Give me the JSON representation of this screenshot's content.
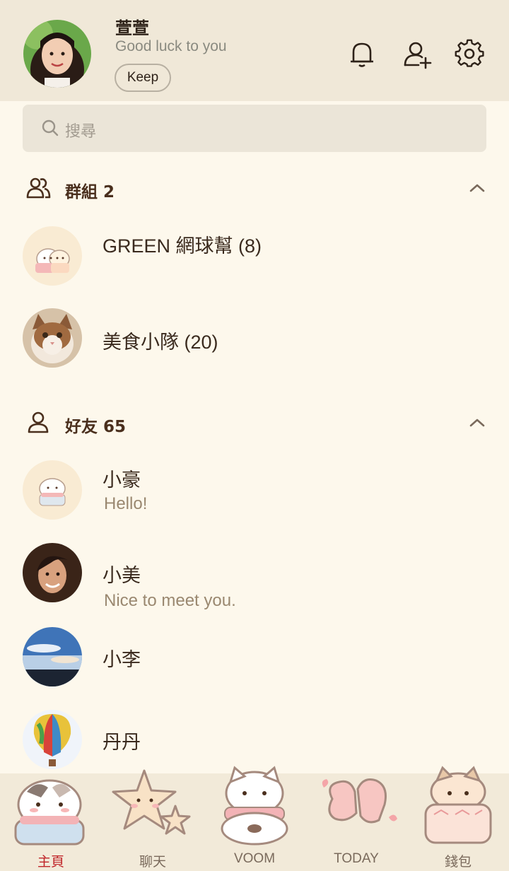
{
  "profile": {
    "name": "萱萱",
    "status": "Good luck to you",
    "keep_label": "Keep"
  },
  "header_icons": [
    "bell-icon",
    "add-friend-icon",
    "settings-gear-icon"
  ],
  "search": {
    "placeholder": "搜尋"
  },
  "groups": {
    "title": "群組 2",
    "items": [
      {
        "name": "GREEN 網球幫 (8)"
      },
      {
        "name": "美食小隊 (20)"
      }
    ]
  },
  "friends": {
    "title": "好友 65",
    "items": [
      {
        "name": "小豪",
        "status": "Hello!"
      },
      {
        "name": "小美",
        "status": "Nice to meet you."
      },
      {
        "name": "小李",
        "status": ""
      },
      {
        "name": "丹丹",
        "status": ""
      }
    ]
  },
  "tabs": [
    {
      "label": "主頁",
      "active": true
    },
    {
      "label": "聊天",
      "active": false
    },
    {
      "label": "VOOM",
      "active": false
    },
    {
      "label": "TODAY",
      "active": false
    },
    {
      "label": "錢包",
      "active": false
    }
  ],
  "colors": {
    "header_bg": "#f0e8d8",
    "page_bg": "#fdf8ec",
    "active_tab": "#c0262a",
    "accent_text": "#4a2f1d"
  }
}
